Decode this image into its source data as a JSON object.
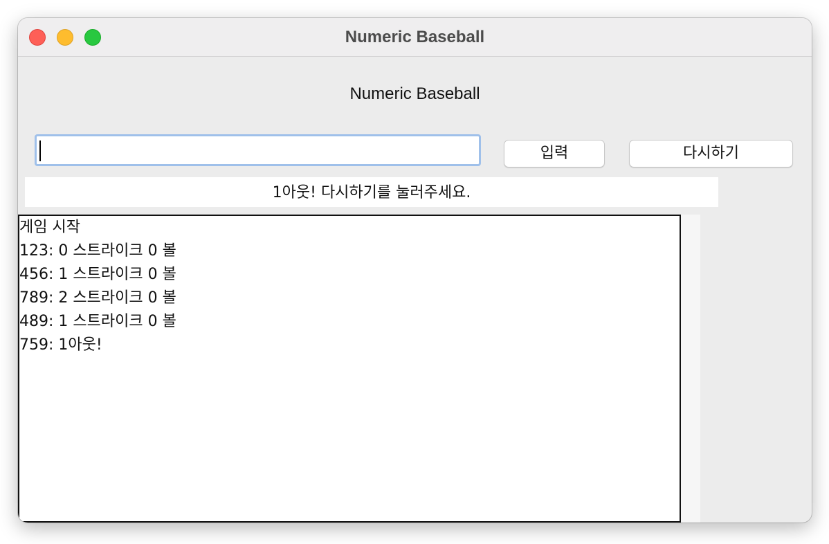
{
  "window": {
    "title": "Numeric Baseball"
  },
  "app": {
    "heading": "Numeric Baseball"
  },
  "input": {
    "value": "",
    "placeholder": ""
  },
  "buttons": {
    "submit_label": "입력",
    "restart_label": "다시하기"
  },
  "status": {
    "message": "1아웃! 다시하기를 눌러주세요."
  },
  "log": {
    "lines": [
      "게임 시작",
      "123: 0 스트라이크 0 볼",
      "456: 1 스트라이크 0 볼",
      "789: 2 스트라이크 0 볼",
      "489: 1 스트라이크 0 볼",
      "759: 1아웃!"
    ]
  },
  "colors": {
    "close": "#fe5f57",
    "minimize": "#febc2e",
    "zoom": "#28c840",
    "input_focus_border": "#9fc0ea"
  }
}
